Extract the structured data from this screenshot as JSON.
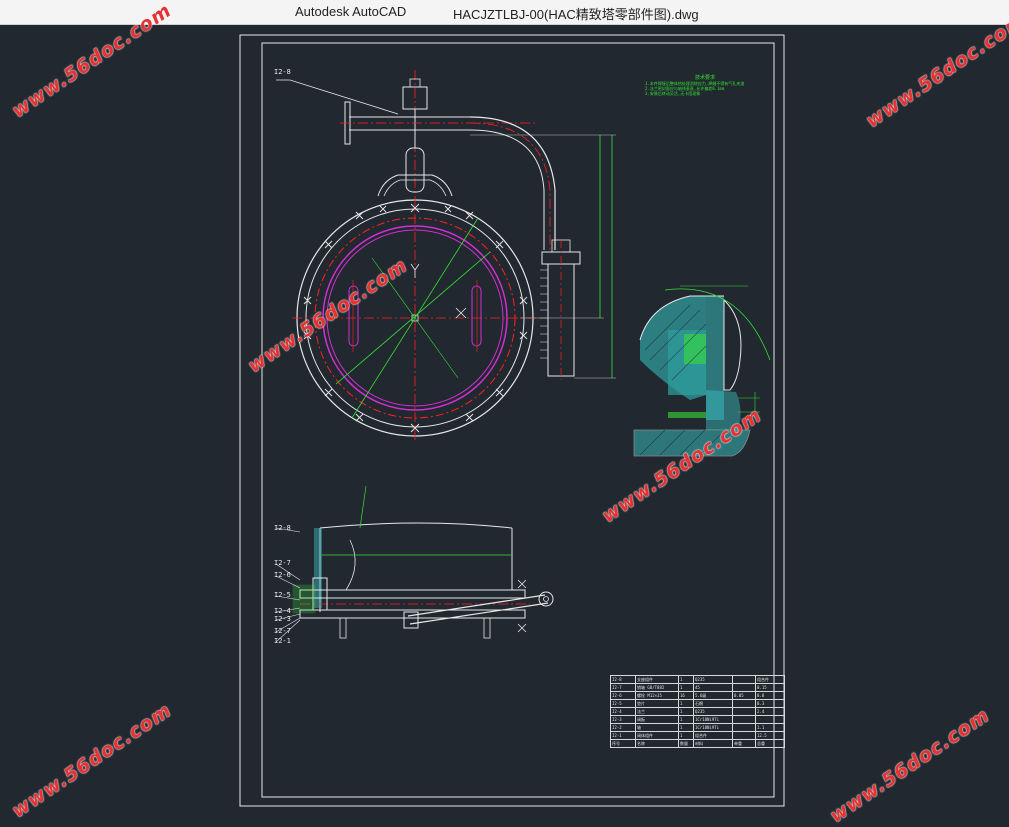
{
  "titlebar": {
    "app_name": "Autodesk AutoCAD",
    "document_name": "HACJZTLBJ-00(HAC精致塔零部件图).dwg"
  },
  "watermark": {
    "text": "www.56doc.com",
    "color": "#e63232"
  },
  "drawing": {
    "frame_color": "#e8e8e8",
    "center_line_color": "#ff2020",
    "dimension_color": "#35e035",
    "part_color": "#d22fd2",
    "hatch_color": "#39c4c4",
    "part_tags": {
      "top": "I2-8",
      "side": [
        "I2-8",
        "I2-7",
        "I2-6",
        "I2-5",
        "I2-4",
        "I2-3",
        "I2-7",
        "I2-1"
      ]
    },
    "notes": {
      "heading": "技术要求",
      "lines": [
        "1.本件焊接后整体热处理消除应力,焊缝不得有气孔夹渣",
        "2.法兰密封面应与轴线垂直,允许偏差0.1mm",
        "3.安装后转动灵活,无卡阻现象"
      ]
    },
    "bom_rows": [
      [
        "I2-8",
        "支座组件",
        "1",
        "Q235",
        "",
        "组合件"
      ],
      [
        "I2-7",
        "销轴 GB/T882",
        "1",
        "45",
        "",
        "0.15"
      ],
      [
        "I2-6",
        "螺栓 M12×35",
        "16",
        "5.6级",
        "0.05",
        "0.8"
      ],
      [
        "I2-5",
        "垫片",
        "1",
        "石棉",
        "",
        "0.3"
      ],
      [
        "I2-4",
        "法兰",
        "1",
        "Q235",
        "",
        "2.4"
      ],
      [
        "I2-3",
        "阀板",
        "1",
        "1Cr18Ni9Ti",
        "",
        ""
      ],
      [
        "I2-2",
        "轴",
        "1",
        "1Cr18Ni9Ti",
        "",
        "1.1"
      ],
      [
        "I2-1",
        "阀体组件",
        "1",
        "组合件",
        "",
        "12.5"
      ],
      [
        "序号",
        "名称",
        "数量",
        "材料",
        "单重",
        "总重"
      ]
    ]
  }
}
